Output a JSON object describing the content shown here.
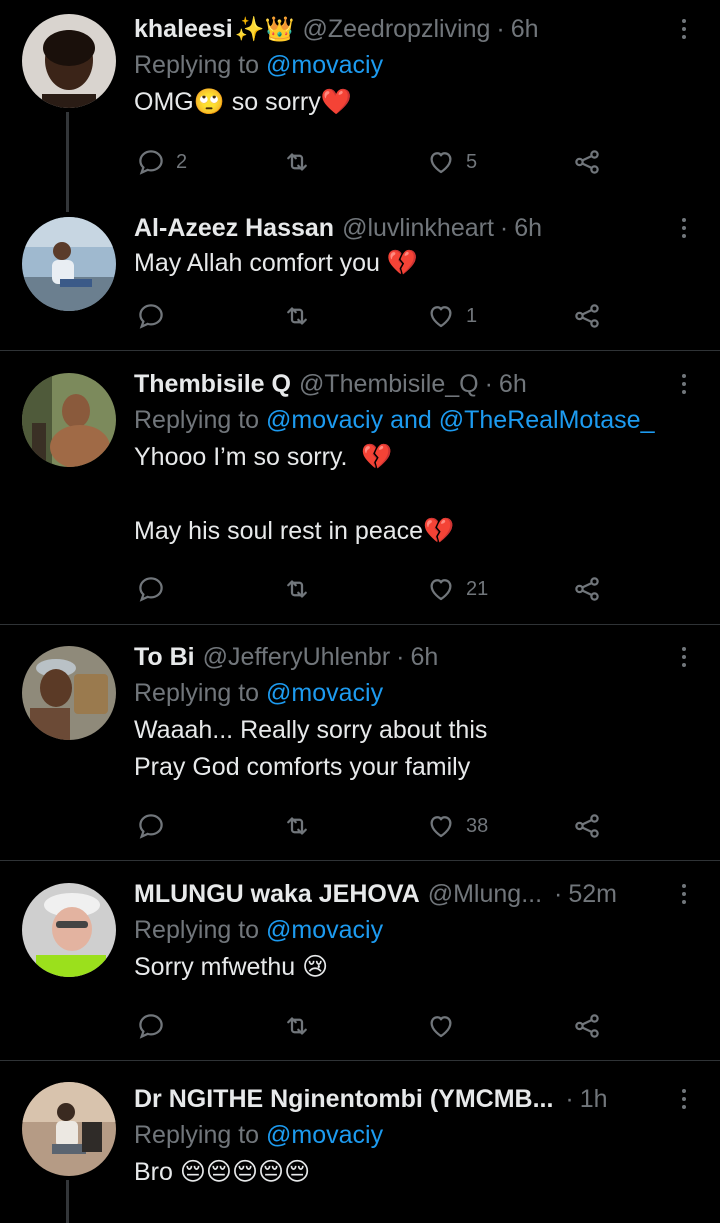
{
  "replying_prefix": "Replying to",
  "and_word": "and",
  "tweets": [
    {
      "name": "khaleesi",
      "badges": "✨👑",
      "handle": "@Zeedropzliving",
      "time": "6h",
      "replying_to": [
        "@movaciy"
      ],
      "text": "OMG🙄 so sorry❤️",
      "counts": {
        "reply": "2",
        "retweet": "",
        "like": "5"
      }
    },
    {
      "name": "Al-Azeez Hassan",
      "badges": "",
      "handle": "@luvlinkheart",
      "time": "6h",
      "replying_to": [],
      "text": "May Allah comfort you 💔",
      "counts": {
        "reply": "",
        "retweet": "",
        "like": "1"
      }
    },
    {
      "name": "Thembisile Q",
      "badges": "",
      "handle": "@Thembisile_Q",
      "time": "6h",
      "replying_to": [
        "@movaciy",
        "@TheRealMotase_"
      ],
      "text": "Yhooo I’m so sorry.  💔\n\nMay his soul rest in peace💔",
      "counts": {
        "reply": "",
        "retweet": "",
        "like": "21"
      }
    },
    {
      "name": "To Bi",
      "badges": "",
      "handle": "@JefferyUhlenbr",
      "time": "6h",
      "replying_to": [
        "@movaciy"
      ],
      "text": "Waaah... Really sorry about this\nPray God comforts your family",
      "counts": {
        "reply": "",
        "retweet": "",
        "like": "38"
      }
    },
    {
      "name": "MLUNGU waka JEHOVA",
      "badges": "",
      "handle": "@Mlung...",
      "time": "52m",
      "replying_to": [
        "@movaciy"
      ],
      "text": "Sorry mfwethu 😢",
      "counts": {
        "reply": "",
        "retweet": "",
        "like": ""
      }
    },
    {
      "name": "Dr NGITHE Nginentombi (YMCMB...",
      "badges": "",
      "handle": "",
      "time": "1h",
      "replying_to": [
        "@movaciy"
      ],
      "text": "Bro 😔😔😔😔😔",
      "counts": {
        "reply": "",
        "retweet": "",
        "like": ""
      }
    }
  ],
  "colors": {
    "background": "#000000",
    "text": "#e7e9ea",
    "secondary": "#71767b",
    "link": "#1d9bf0",
    "divider": "#2f3336"
  }
}
